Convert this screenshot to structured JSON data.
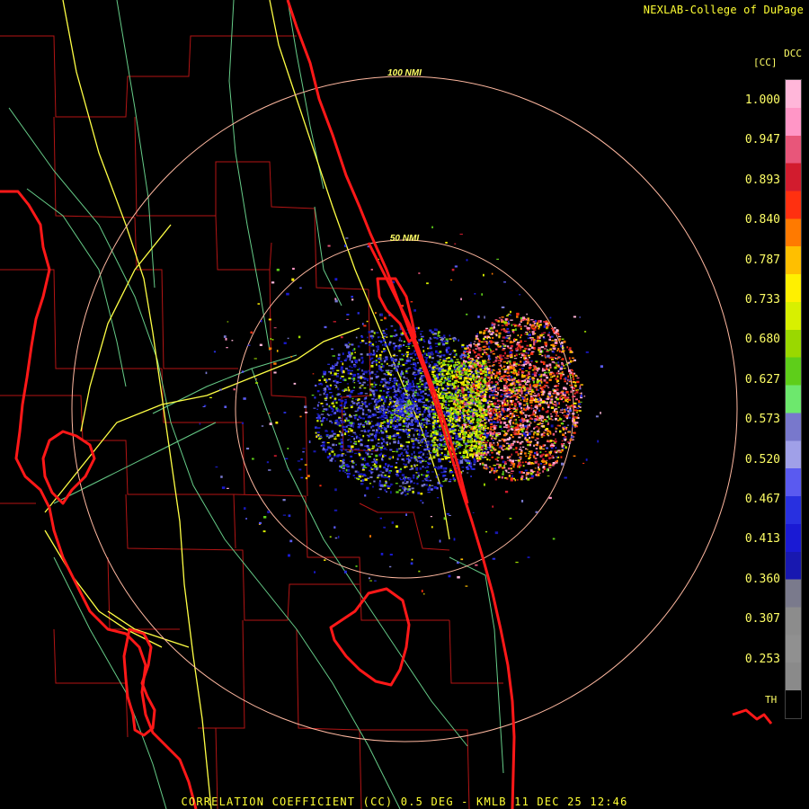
{
  "header": {
    "credit": "NEXLAB-College of DuPage"
  },
  "legend": {
    "product_code": "DCC",
    "unit": "[CC]",
    "ticks": [
      "1.000",
      "0.947",
      "0.893",
      "0.840",
      "0.787",
      "0.733",
      "0.680",
      "0.627",
      "0.573",
      "0.520",
      "0.467",
      "0.413",
      "0.360",
      "0.307",
      "0.253"
    ],
    "threshold_label": "TH",
    "palette": [
      "#ffb6d9",
      "#ff96c6",
      "#e8567a",
      "#d21c2e",
      "#ff3010",
      "#ff7a00",
      "#ffbf00",
      "#fff000",
      "#d8f000",
      "#9ad800",
      "#5ece1a",
      "#6de86d",
      "#7878cc",
      "#a0a0e8",
      "#5a5af0",
      "#2830e0",
      "#1a1ad4",
      "#1818b0",
      "#7a7a8c",
      "#8c8c8c",
      "#909090",
      "#8a8a8a",
      "#000000"
    ]
  },
  "rings": {
    "inner_label": "50 NMI",
    "outer_label": "100 NMI"
  },
  "footer": {
    "caption": "CORRELATION COEFFICIENT (CC) 0.5 DEG - KMLB 11 DEC 25 12:46"
  },
  "colors": {
    "coastline": "#ff1818",
    "county_lines": "#b31515",
    "highways": "#ffff44",
    "roads": "#66cc88",
    "range_rings": "#ffb8a0",
    "text": "#ffff33"
  }
}
